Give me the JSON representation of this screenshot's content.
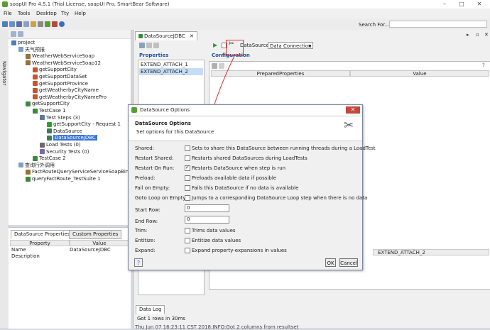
{
  "window": {
    "title": "soapUI Pro 4.5.1 (Trial License, soapUI Pro, SmartBear Software)",
    "min_glyph": "–",
    "max_glyph": "□",
    "close_glyph": "✕"
  },
  "menu": [
    "File",
    "Tools",
    "Desktop",
    "Tty",
    "Help"
  ],
  "search": {
    "label": "Search For...",
    "value": ""
  },
  "navigator": {
    "label": "Navigator"
  },
  "tree": [
    {
      "label": "project",
      "depth": 0,
      "icon": "project-icon"
    },
    {
      "label": "天气预报",
      "depth": 1,
      "icon": "folder-icon"
    },
    {
      "label": "WeatherWebServiceSoap",
      "depth": 2,
      "icon": "interface-icon"
    },
    {
      "label": "WeatherWebServiceSoap12",
      "depth": 2,
      "icon": "interface-icon"
    },
    {
      "label": "getSupportCity",
      "depth": 3,
      "icon": "operation-icon"
    },
    {
      "label": "getSupportDataSet",
      "depth": 3,
      "icon": "operation-icon"
    },
    {
      "label": "getSupportProvince",
      "depth": 3,
      "icon": "operation-icon"
    },
    {
      "label": "getWeatherbyCityName",
      "depth": 3,
      "icon": "operation-icon"
    },
    {
      "label": "getWeatherbyCityNamePro",
      "depth": 3,
      "icon": "operation-icon"
    },
    {
      "label": "getSupportCity",
      "depth": 2,
      "icon": "testsuite-icon"
    },
    {
      "label": "TestCase 1",
      "depth": 3,
      "icon": "testcase-icon"
    },
    {
      "label": "Test Steps (3)",
      "depth": 4,
      "icon": "steps-icon"
    },
    {
      "label": "getSupportCity - Request 1",
      "depth": 5,
      "icon": "request-icon"
    },
    {
      "label": "DataSource",
      "depth": 5,
      "icon": "datasource-icon"
    },
    {
      "label": "DataSourceJDBC",
      "depth": 5,
      "icon": "datasource-icon",
      "selected": true
    },
    {
      "label": "Load Tests (0)",
      "depth": 4,
      "icon": "loadtest-icon"
    },
    {
      "label": "Security Tests (0)",
      "depth": 4,
      "icon": "security-icon"
    },
    {
      "label": "TestCase 2",
      "depth": 3,
      "icon": "testcase-icon"
    },
    {
      "label": "查询行外调用",
      "depth": 1,
      "icon": "folder-icon"
    },
    {
      "label": "FactRouteQueryServiceServiceSoapBinding",
      "depth": 2,
      "icon": "interface-icon"
    },
    {
      "label": "queryFactRoute_TestSuite 1",
      "depth": 2,
      "icon": "testsuite-icon"
    }
  ],
  "props_panel": {
    "tabs": [
      "DataSource Properties",
      "Custom Properties"
    ],
    "headers": [
      "Property",
      "Value"
    ],
    "rows": [
      {
        "property": "Name",
        "value": "DataSourceJDBC"
      },
      {
        "property": "Description",
        "value": ""
      }
    ]
  },
  "editor": {
    "tab": "DataSourceJDBC",
    "properties_title": "Properties",
    "properties": [
      "EXTEND_ATTACH_1",
      "EXTEND_ATTACH_2"
    ],
    "datasource_label": "DataSource:",
    "datasource_value": "Data Connection",
    "configuration_label": "Configuration",
    "table_headers": [
      "PreparedProperties",
      "Value"
    ],
    "extend_attach_col": "EXTEND_ATTACH_2",
    "log_tab": "Data Log",
    "log_text": "Got 1 rows in 30ms",
    "status_text": "Thu Jun 07 16:23:11 CST 2018:INFO:Got 2 columns from resultset"
  },
  "dialog": {
    "title": "DataSource Options",
    "header_title": "DataSource Options",
    "header_subtitle": "Set options for this DataSource",
    "fields": [
      {
        "label": "Shared:",
        "desc": "Sets to share this DataSource between running threads during a LoadTest",
        "checked": false
      },
      {
        "label": "Restart Shared:",
        "desc": "Restarts shared DataSources during LoadTests",
        "checked": false
      },
      {
        "label": "Restart On Run:",
        "desc": "Restarts DataSource when step is run",
        "checked": true
      },
      {
        "label": "Preload:",
        "desc": "Preloads available data if possible",
        "checked": false
      },
      {
        "label": "Fail on Empty:",
        "desc": "Fails this DataSource if no data is available",
        "checked": false
      },
      {
        "label": "Goto Loop on Empty:",
        "desc": "Jumps to a corresponding DataSource Loop step when there is no data",
        "checked": false
      }
    ],
    "start_row_label": "Start Row:",
    "start_row_value": "0",
    "end_row_label": "End Row:",
    "end_row_value": "0",
    "fields2": [
      {
        "label": "Trim:",
        "desc": "Trims data values",
        "checked": false
      },
      {
        "label": "Entitize:",
        "desc": "Entitize data values",
        "checked": false
      },
      {
        "label": "Expand:",
        "desc": "Expand property-expansions in values",
        "checked": false
      }
    ],
    "ok_label": "OK",
    "cancel_label": "Cancel"
  },
  "colors": {
    "selection": "#3875d7",
    "annotation": "#e0322d",
    "dialog_close": "#c7463b"
  }
}
